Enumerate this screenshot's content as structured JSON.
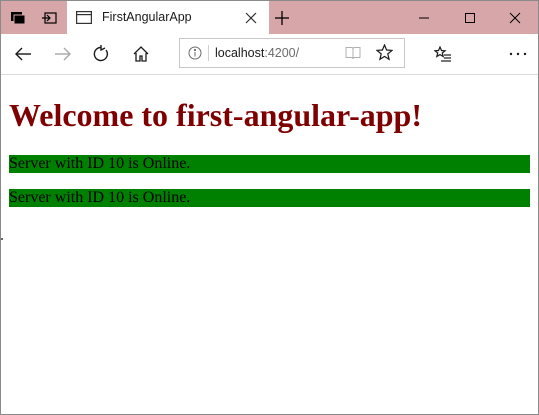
{
  "browser": {
    "tab_title": "FirstAngularApp",
    "url_host": "localhost",
    "url_port": ":4200/"
  },
  "page": {
    "heading": "Welcome to first-angular-app!",
    "servers": [
      {
        "text": "Server with ID 10 is Online.",
        "status_color": "#008000"
      },
      {
        "text": "Server with ID 10 is Online.",
        "status_color": "#008000"
      }
    ]
  },
  "colors": {
    "titlebar": "#d6a6a8",
    "heading": "#7f0000",
    "online": "#008000"
  }
}
